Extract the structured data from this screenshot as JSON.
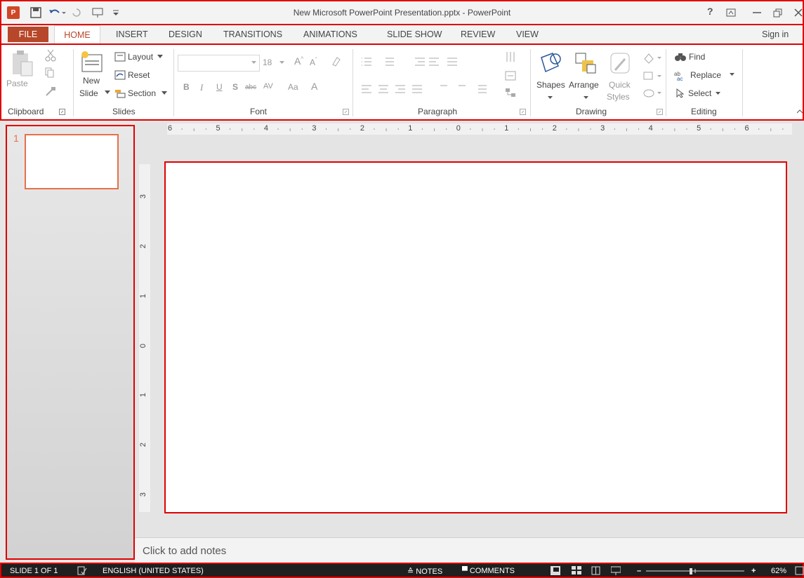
{
  "window": {
    "title": "New Microsoft PowerPoint Presentation.pptx - PowerPoint",
    "logo_text": "P"
  },
  "tabs": [
    "FILE",
    "HOME",
    "INSERT",
    "DESIGN",
    "TRANSITIONS",
    "ANIMATIONS",
    "SLIDE SHOW",
    "REVIEW",
    "VIEW"
  ],
  "sign_in": "Sign in",
  "ribbon": {
    "clipboard": {
      "paste": "Paste",
      "label": "Clipboard"
    },
    "slides": {
      "new_slide_1": "New",
      "new_slide_2": "Slide",
      "layout": "Layout",
      "reset": "Reset",
      "section": "Section",
      "label": "Slides"
    },
    "font": {
      "size": "18",
      "label": "Font",
      "strike": "abc",
      "av": "AV",
      "case": "Aa"
    },
    "paragraph": {
      "label": "Paragraph"
    },
    "drawing": {
      "shapes": "Shapes",
      "arrange": "Arrange",
      "quick_1": "Quick",
      "quick_2": "Styles",
      "label": "Drawing"
    },
    "editing": {
      "find": "Find",
      "replace": "Replace",
      "select": "Select",
      "label": "Editing"
    }
  },
  "ruler": {
    "h_ticks": [
      "6",
      "5",
      "4",
      "3",
      "2",
      "1",
      "0",
      "1",
      "2",
      "3",
      "4",
      "5",
      "6"
    ],
    "v_ticks": [
      "3",
      "2",
      "1",
      "0",
      "1",
      "2",
      "3"
    ]
  },
  "thumbnails": [
    {
      "number": "1"
    }
  ],
  "notes_placeholder": "Click to add notes",
  "status": {
    "slide": "SLIDE 1 OF 1",
    "language": "ENGLISH (UNITED STATES)",
    "notes": "NOTES",
    "comments": "COMMENTS",
    "zoom": "62%"
  },
  "colors": {
    "accent": "#b7472a",
    "thumb_border": "#e8704a",
    "annotation_red": "#e00000"
  }
}
